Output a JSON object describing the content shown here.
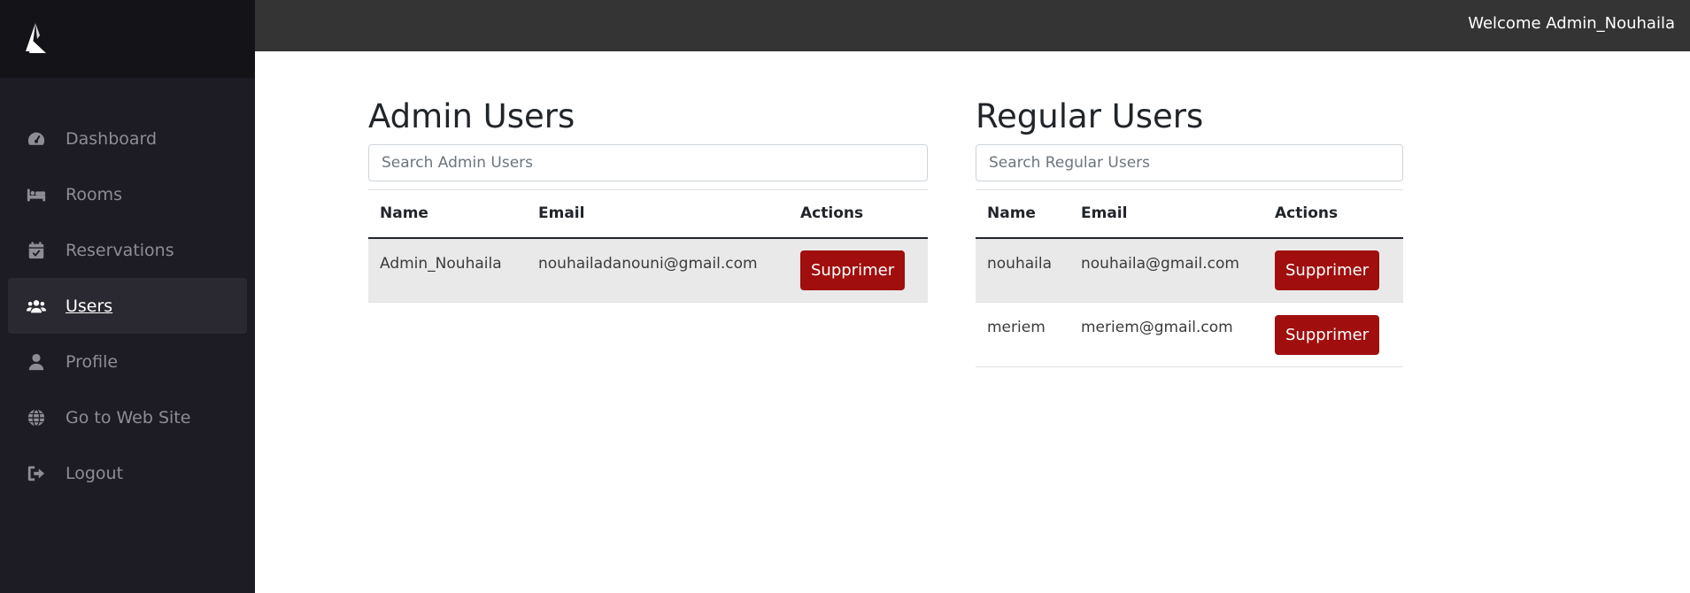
{
  "topbar": {
    "welcome": "Welcome Admin_Nouhaila"
  },
  "sidebar": {
    "logo": "logo-icon",
    "items": [
      {
        "label": "Dashboard",
        "icon": "gauge-icon",
        "active": false
      },
      {
        "label": "Rooms",
        "icon": "bed-icon",
        "active": false
      },
      {
        "label": "Reservations",
        "icon": "calendar-check-icon",
        "active": false
      },
      {
        "label": "Users",
        "icon": "users-icon",
        "active": true
      },
      {
        "label": "Profile",
        "icon": "user-icon",
        "active": false
      },
      {
        "label": "Go to Web Site",
        "icon": "globe-icon",
        "active": false
      },
      {
        "label": "Logout",
        "icon": "logout-icon",
        "active": false
      }
    ]
  },
  "admin": {
    "title": "Admin Users",
    "search_placeholder": "Search Admin Users",
    "columns": [
      "Name",
      "Email",
      "Actions"
    ],
    "rows": [
      {
        "name": "Admin_Nouhaila",
        "email": "nouhailadanouni@gmail.com",
        "action": "Supprimer"
      }
    ]
  },
  "regular": {
    "title": "Regular Users",
    "search_placeholder": "Search Regular Users",
    "columns": [
      "Name",
      "Email",
      "Actions"
    ],
    "rows": [
      {
        "name": "nouhaila",
        "email": "nouhaila@gmail.com",
        "action": "Supprimer"
      },
      {
        "name": "meriem",
        "email": "meriem@gmail.com",
        "action": "Supprimer"
      }
    ]
  },
  "colors": {
    "sidebar": "#1d1c24",
    "topbar": "#343434",
    "danger": "#a00e0e"
  }
}
